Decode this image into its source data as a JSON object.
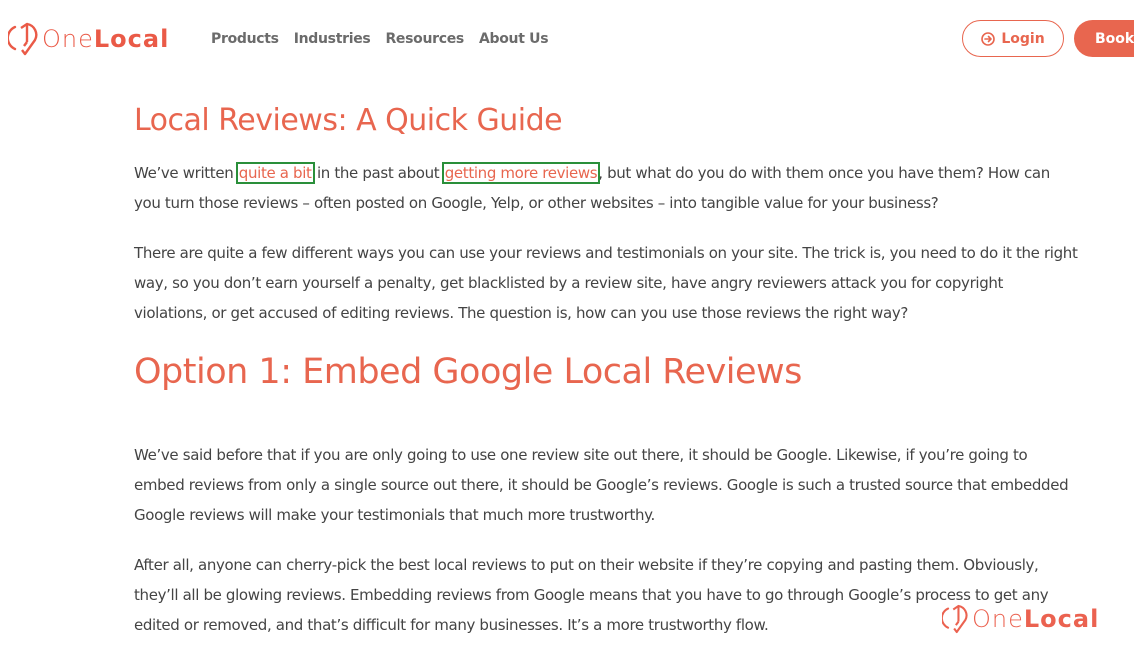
{
  "header": {
    "logo": {
      "icon": "onelocal-pin-icon",
      "text_light": "One",
      "text_bold": "Local"
    },
    "nav": [
      {
        "label": "Products"
      },
      {
        "label": "Industries"
      },
      {
        "label": "Resources"
      },
      {
        "label": "About Us"
      }
    ],
    "login": {
      "label": "Login",
      "icon": "arrow-circle-right-icon"
    },
    "book": {
      "label": "Book"
    }
  },
  "article": {
    "title": "Local Reviews: A Quick Guide",
    "p1": {
      "pre": "We’ve written ",
      "link1": "quite a bit",
      "mid": " in the past about ",
      "link2": "getting more reviews",
      "post": ", but what do you do with them once you have them? How can you turn those reviews – often posted on Google, Yelp, or other websites – into tangible value for your business?"
    },
    "p2": "There are quite a few different ways you can use your reviews and testimonials on your site. The trick is, you need to do it the right way, so you don’t earn yourself a penalty, get blacklisted by a review site, have angry reviewers attack you for copyright violations, or get accused of editing reviews. The question is, how can you use those reviews the right way?",
    "option1_title": "Option 1: Embed Google Local Reviews",
    "p3": "We’ve said before that if you are only going to use one review site out there, it should be Google. Likewise, if you’re going to embed reviews from only a single source out there, it should be Google’s reviews. Google is such a trusted source that embedded Google reviews will make your testimonials that much more trustworthy.",
    "p4": "After all, anyone can cherry-pick the best local reviews to put on their website if they’re copying and pasting them. Obviously, they’ll all be glowing reviews. Embedding reviews from Google means that you have to go through Google’s process to get any edited or removed, and that’s difficult for many businesses. It’s a more trustworthy flow."
  },
  "watermark": {
    "text_light": "One",
    "text_bold": "Local"
  },
  "colors": {
    "brand": "#e8664f",
    "nav_text": "#6b6b6b",
    "body_text": "#444444",
    "link_highlight": "#2a8f3a"
  }
}
